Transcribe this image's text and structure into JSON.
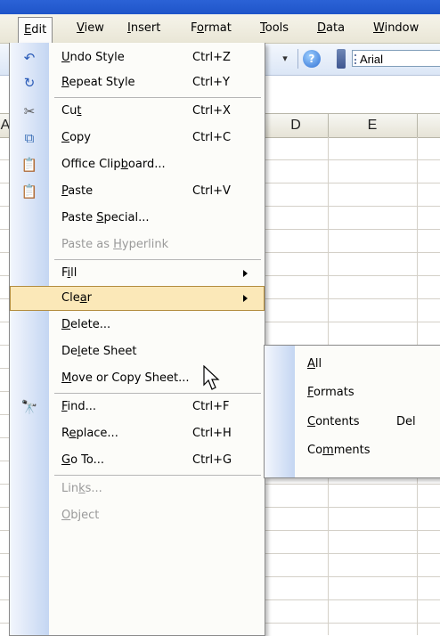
{
  "menubar": {
    "items": [
      {
        "label": "Edit",
        "ul": "E",
        "rest": "dit"
      },
      {
        "label": "View",
        "ul": "V",
        "rest": "iew"
      },
      {
        "label": "Insert",
        "ul": "I",
        "rest": "nsert"
      },
      {
        "label": "Format",
        "pre": "F",
        "ul": "o",
        "rest": "rmat"
      },
      {
        "label": "Tools",
        "ul": "T",
        "rest": "ools"
      },
      {
        "label": "Data",
        "ul": "D",
        "rest": "ata"
      },
      {
        "label": "Window",
        "ul": "W",
        "rest": "indow"
      }
    ]
  },
  "toolbar": {
    "dropdown_glyph": "▾",
    "help_glyph": "?",
    "font_name": "Arial"
  },
  "sheet": {
    "col_headers": [
      "A",
      "D",
      "E"
    ]
  },
  "edit_menu": {
    "items": [
      {
        "pre": "",
        "ul": "U",
        "post": "ndo Style",
        "shortcut": "Ctrl+Z",
        "icon": "undo-icon",
        "glyph": "↶"
      },
      {
        "pre": "",
        "ul": "R",
        "post": "epeat Style",
        "shortcut": "Ctrl+Y",
        "icon": "repeat-icon",
        "glyph": "↻"
      },
      {
        "pre": "Cu",
        "ul": "t",
        "post": "",
        "shortcut": "Ctrl+X",
        "icon": "scissors-icon",
        "glyph": "✂"
      },
      {
        "pre": "",
        "ul": "C",
        "post": "opy",
        "shortcut": "Ctrl+C",
        "icon": "copy-icon",
        "glyph": "⧉"
      },
      {
        "pre": "Office Clip",
        "ul": "b",
        "post": "oard...",
        "shortcut": "",
        "icon": "clipboard-icon",
        "glyph": "📋"
      },
      {
        "pre": "",
        "ul": "P",
        "post": "aste",
        "shortcut": "Ctrl+V",
        "icon": "paste-icon",
        "glyph": "📋"
      },
      {
        "pre": "Paste ",
        "ul": "S",
        "post": "pecial...",
        "shortcut": "",
        "icon": ""
      },
      {
        "pre": "Paste as ",
        "ul": "H",
        "post": "yperlink",
        "shortcut": "",
        "icon": "",
        "disabled": true
      },
      {
        "pre": "F",
        "ul": "i",
        "post": "ll",
        "shortcut": "",
        "icon": "",
        "submenu": true
      },
      {
        "pre": "Cle",
        "ul": "a",
        "post": "r",
        "shortcut": "",
        "icon": "",
        "submenu": true,
        "highlight": true
      },
      {
        "pre": "",
        "ul": "D",
        "post": "elete...",
        "shortcut": "",
        "icon": ""
      },
      {
        "pre": "De",
        "ul": "l",
        "post": "ete Sheet",
        "shortcut": "",
        "icon": ""
      },
      {
        "pre": "",
        "ul": "M",
        "post": "ove or Copy Sheet...",
        "shortcut": "",
        "icon": ""
      },
      {
        "pre": "",
        "ul": "F",
        "post": "ind...",
        "shortcut": "Ctrl+F",
        "icon": "binoculars-icon",
        "glyph": "🔭"
      },
      {
        "pre": "R",
        "ul": "e",
        "post": "place...",
        "shortcut": "Ctrl+H",
        "icon": ""
      },
      {
        "pre": "",
        "ul": "G",
        "post": "o To...",
        "shortcut": "Ctrl+G",
        "icon": ""
      },
      {
        "pre": "Lin",
        "ul": "k",
        "post": "s...",
        "shortcut": "",
        "icon": "",
        "disabled": true
      },
      {
        "pre": "",
        "ul": "O",
        "post": "bject",
        "shortcut": "",
        "icon": "",
        "disabled": true
      }
    ]
  },
  "clear_submenu": {
    "items": [
      {
        "pre": "",
        "ul": "A",
        "post": "ll",
        "shortcut": ""
      },
      {
        "pre": "",
        "ul": "F",
        "post": "ormats",
        "shortcut": ""
      },
      {
        "pre": "",
        "ul": "C",
        "post": "ontents",
        "shortcut": "Del"
      },
      {
        "pre": "Co",
        "ul": "m",
        "post": "ments",
        "shortcut": ""
      }
    ]
  }
}
